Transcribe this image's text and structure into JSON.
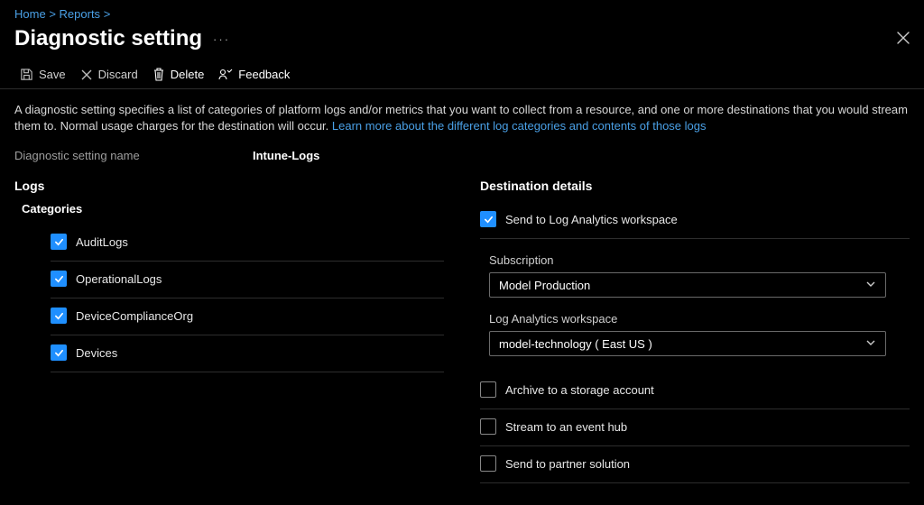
{
  "breadcrumb": {
    "home": "Home",
    "reports": "Reports",
    "sep": ">"
  },
  "page": {
    "title": "Diagnostic setting",
    "more": "···"
  },
  "toolbar": {
    "save": "Save",
    "discard": "Discard",
    "delete": "Delete",
    "feedback": "Feedback"
  },
  "description": {
    "text": "A diagnostic setting specifies a list of categories of platform logs and/or metrics that you want to collect from a resource, and one or more destinations that you would stream them to. Normal usage charges for the destination will occur. ",
    "link": "Learn more about the different log categories and contents of those logs"
  },
  "name_field": {
    "label": "Diagnostic setting name",
    "value": "Intune-Logs"
  },
  "logs": {
    "title": "Logs",
    "categories_label": "Categories",
    "items": [
      {
        "label": "AuditLogs",
        "checked": true
      },
      {
        "label": "OperationalLogs",
        "checked": true
      },
      {
        "label": "DeviceComplianceOrg",
        "checked": true
      },
      {
        "label": "Devices",
        "checked": true
      }
    ]
  },
  "destination": {
    "title": "Destination details",
    "send_law": {
      "label": "Send to Log Analytics workspace",
      "checked": true
    },
    "subscription": {
      "label": "Subscription",
      "value": "Model Production"
    },
    "workspace": {
      "label": "Log Analytics workspace",
      "value": "model-technology ( East US )"
    },
    "archive": {
      "label": "Archive to a storage account",
      "checked": false
    },
    "stream": {
      "label": "Stream to an event hub",
      "checked": false
    },
    "partner": {
      "label": "Send to partner solution",
      "checked": false
    }
  }
}
